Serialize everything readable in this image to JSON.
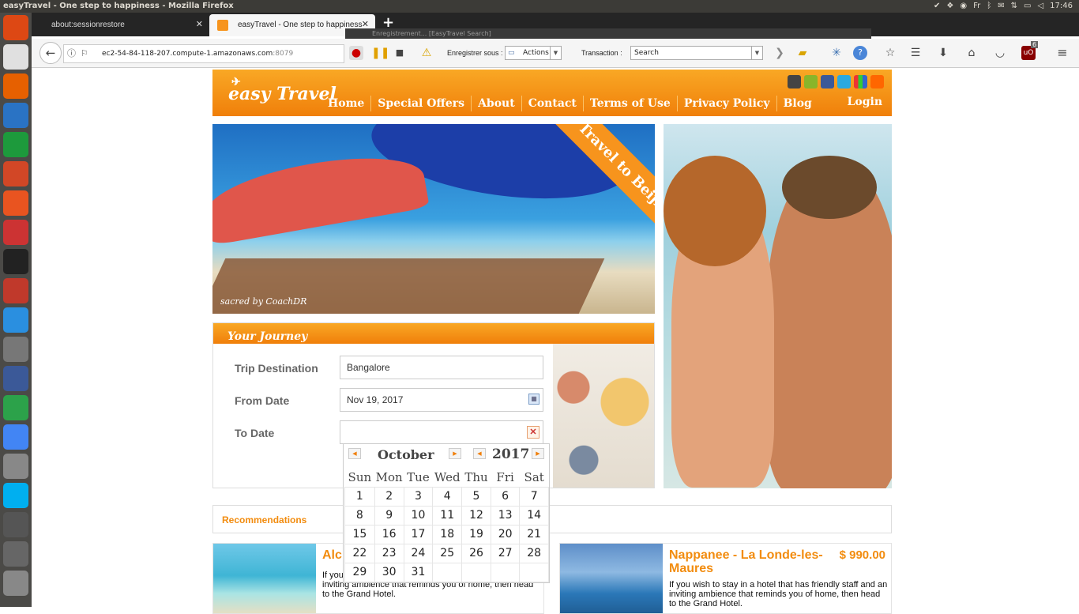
{
  "os": {
    "window_title": "easyTravel - One step to happiness - Mozilla Firefox",
    "clock": "17:46",
    "kbd": "Fr",
    "dock_icons": [
      "ubuntu-icon",
      "files-icon",
      "firefox-icon",
      "writer-icon",
      "calc-icon",
      "impress-icon",
      "software-center-icon",
      "settings-icon",
      "amazon-icon",
      "intellij-icon",
      "dropbox-icon",
      "gimp-icon",
      "network-icon",
      "pinwheel-icon",
      "chrome-icon",
      "help-icon",
      "skype-icon",
      "disk-icon",
      "usb-icon",
      "printer-icon"
    ]
  },
  "browser": {
    "tabs": [
      {
        "label": "about:sessionrestore"
      },
      {
        "label": "easyTravel - One step to happiness"
      }
    ],
    "recorder_title": "Enregistrement... [EasyTravel Search]",
    "url_host": "ec2-54-84-118-207.compute-1.amazonaws.com",
    "url_port": ":8079",
    "toolbar": {
      "save_as_label": "Enregistrer sous :",
      "actions_value": "Actions",
      "transaction_label": "Transaction :",
      "transaction_value": "Search"
    },
    "ublock_count": "6"
  },
  "site": {
    "logo": "easy Travel",
    "nav": [
      "Home",
      "Special Offers",
      "About",
      "Contact",
      "Terms of Use",
      "Privacy Policy",
      "Blog"
    ],
    "login": "Login",
    "banner_ribbon": "Travel to Beijing",
    "banner_credit": "sacred by CoachDR",
    "journey": {
      "title": "Your Journey",
      "destination_label": "Trip Destination",
      "destination_value": "Bangalore",
      "from_label": "From Date",
      "from_value": "Nov 19, 2017",
      "to_label": "To Date",
      "to_value": ""
    },
    "recommendations_title": "Recommendations",
    "hotels": [
      {
        "name": "Alc",
        "price": "",
        "desc": "If you wish to stay in a hotel that has friendly staff and an inviting ambience that reminds you of home, then head to the Grand Hotel."
      },
      {
        "name": "Nappanee - La Londe-les-Maures",
        "price": "$ 990.00",
        "desc": "If you wish to stay in a hotel that has friendly staff and an inviting ambience that reminds you of home, then head to the Grand Hotel."
      }
    ],
    "calendar": {
      "month": "October",
      "year": "2017",
      "weekdays": [
        "Sun",
        "Mon",
        "Tue",
        "Wed",
        "Thu",
        "Fri",
        "Sat"
      ],
      "weeks": [
        [
          "1",
          "2",
          "3",
          "4",
          "5",
          "6",
          "7"
        ],
        [
          "8",
          "9",
          "10",
          "11",
          "12",
          "13",
          "14"
        ],
        [
          "15",
          "16",
          "17",
          "18",
          "19",
          "20",
          "21"
        ],
        [
          "22",
          "23",
          "24",
          "25",
          "26",
          "27",
          "28"
        ],
        [
          "29",
          "30",
          "31",
          "",
          "",
          "",
          ""
        ]
      ]
    }
  },
  "colors": {
    "brand_orange": "#f28c0f"
  }
}
